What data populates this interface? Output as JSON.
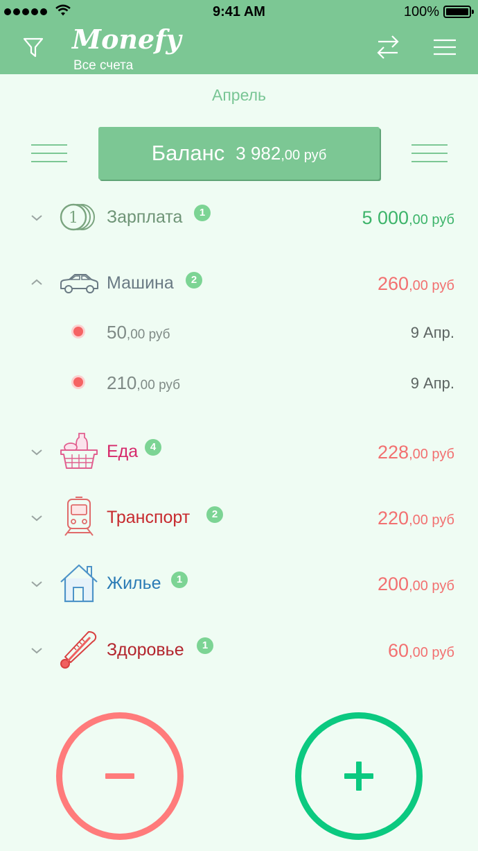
{
  "status_bar": {
    "time": "9:41 AM",
    "battery": "100%"
  },
  "header": {
    "logo": "Monefy",
    "account": "Все счета"
  },
  "month": "Апрель",
  "balance": {
    "label": "Баланс",
    "amount": "3 982",
    "cents": ",00 руб"
  },
  "categories": [
    {
      "name": "Зарплата",
      "count": "1",
      "amount": "5 000",
      "cents": ",00 руб",
      "type": "income",
      "icon": "coins-icon",
      "expanded": false,
      "color": "#7aa47f"
    },
    {
      "name": "Машина",
      "count": "2",
      "amount": "260",
      "cents": ",00 руб",
      "type": "expense",
      "icon": "car-icon",
      "expanded": true,
      "color": "#6a7a84",
      "transactions": [
        {
          "amount": "50",
          "cents": ",00 руб",
          "date": "9 Апр."
        },
        {
          "amount": "210",
          "cents": ",00 руб",
          "date": "9 Апр."
        }
      ]
    },
    {
      "name": "Еда",
      "count": "4",
      "amount": "228",
      "cents": ",00 руб",
      "type": "expense",
      "icon": "food-basket-icon",
      "expanded": false,
      "color": "#d6296b"
    },
    {
      "name": "Транспорт",
      "count": "2",
      "amount": "220",
      "cents": ",00 руб",
      "type": "expense",
      "icon": "train-icon",
      "expanded": false,
      "color": "#c72a2e"
    },
    {
      "name": "Жилье",
      "count": "1",
      "amount": "200",
      "cents": ",00 руб",
      "type": "expense",
      "icon": "house-icon",
      "expanded": false,
      "color": "#2b7bb5"
    },
    {
      "name": "Здоровье",
      "count": "1",
      "amount": "60",
      "cents": ",00 руб",
      "type": "expense",
      "icon": "thermometer-icon",
      "expanded": false,
      "color": "#b3252d"
    }
  ],
  "buttons": {
    "expense": "−",
    "income": "+"
  },
  "colors": {
    "header": "#7cc794",
    "background": "#effcf3",
    "income": "#3db46a",
    "expense": "#f27070",
    "fab_minus": "#ff7b7b",
    "fab_plus": "#0bc980"
  }
}
